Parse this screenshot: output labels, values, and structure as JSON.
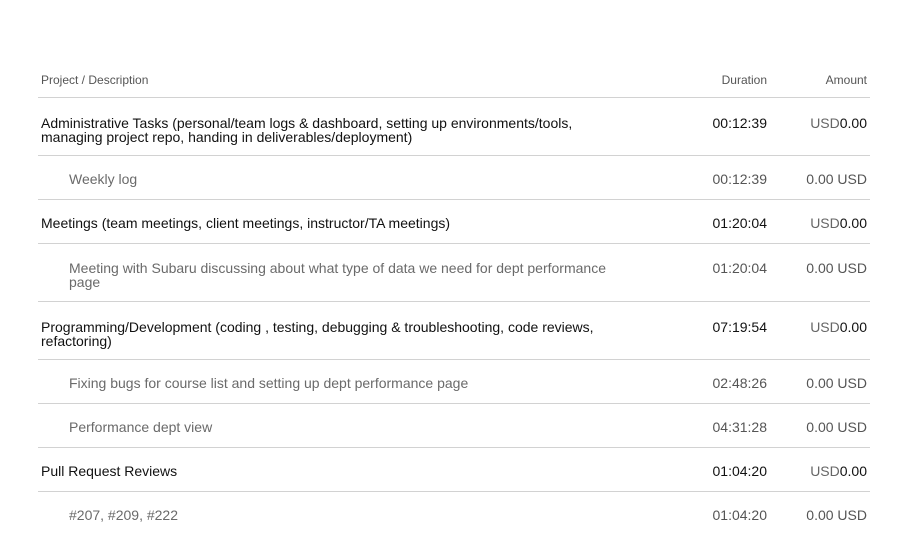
{
  "header": {
    "description": "Project / Description",
    "duration": "Duration",
    "amount": "Amount"
  },
  "rows": [
    {
      "type": "project",
      "description": "Administrative Tasks (personal/team logs & dashboard, setting up environments/tools, managing project repo, handing in deliverables/deployment)",
      "duration": "00:12:39",
      "amount_prefix": "USD",
      "amount_value": "0.00"
    },
    {
      "type": "task",
      "description": "Weekly log",
      "duration": "00:12:39",
      "amount": "0.00 USD"
    },
    {
      "type": "project",
      "description": "Meetings (team meetings, client meetings, instructor/TA meetings)",
      "duration": "01:20:04",
      "amount_prefix": "USD",
      "amount_value": "0.00"
    },
    {
      "type": "task",
      "description": "Meeting with Subaru discussing about what type of data we need for dept performance page",
      "duration": "01:20:04",
      "amount": "0.00 USD"
    },
    {
      "type": "project",
      "description": "Programming/Development (coding , testing, debugging & troubleshooting, code reviews, refactoring)",
      "duration": "07:19:54",
      "amount_prefix": "USD",
      "amount_value": "0.00"
    },
    {
      "type": "task",
      "description": "Fixing bugs for course list and setting up dept performance page",
      "duration": "02:48:26",
      "amount": "0.00 USD"
    },
    {
      "type": "task",
      "description": "Performance dept view",
      "duration": "04:31:28",
      "amount": "0.00 USD"
    },
    {
      "type": "project",
      "description": "Pull Request Reviews",
      "duration": "01:04:20",
      "amount_prefix": "USD",
      "amount_value": "0.00"
    },
    {
      "type": "task",
      "description": "#207, #209, #222",
      "duration": "01:04:20",
      "amount": "0.00 USD"
    }
  ]
}
